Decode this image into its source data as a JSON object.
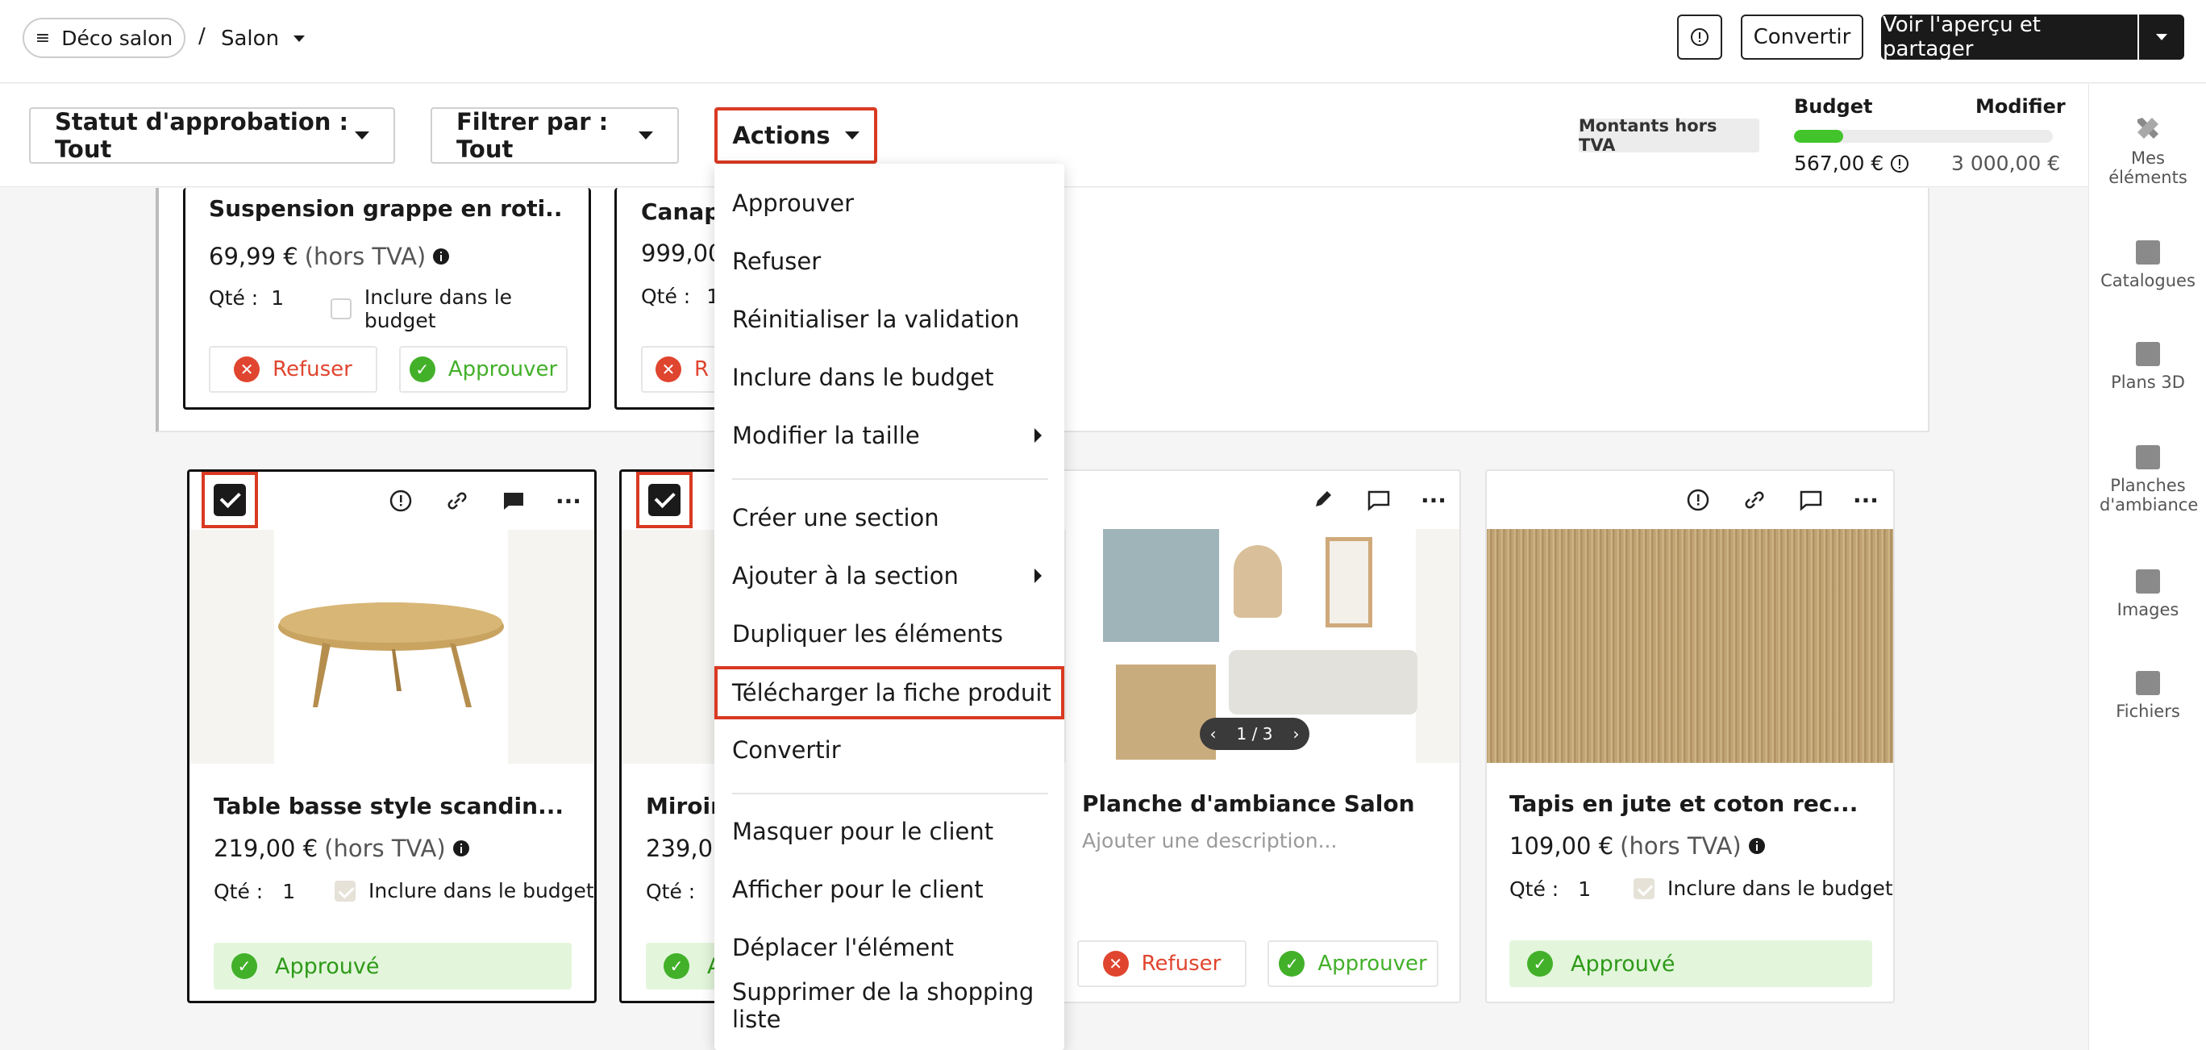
{
  "topbar": {
    "project_label": "Déco salon",
    "separator": "/",
    "room_label": "Salon",
    "convert_label": "Convertir",
    "share_label": "Voir l'aperçu et partager"
  },
  "filters": {
    "approval_status": "Statut d'approbation : Tout",
    "filter_by": "Filtrer par : Tout",
    "actions": "Actions",
    "vat_badge": "Montants hors TVA"
  },
  "budget": {
    "title": "Budget",
    "edit_label": "Modifier",
    "spent": "567,00 €",
    "total": "3 000,00 €",
    "fill_fraction": 0.189
  },
  "sidebar": {
    "items": [
      {
        "label": "Mes éléments",
        "icon": "tools-icon"
      },
      {
        "label": "Catalogues",
        "icon": "book-icon"
      },
      {
        "label": "Plans 3D",
        "icon": "floorplan-icon"
      },
      {
        "label": "Planches d'ambiance",
        "icon": "moodboard-icon"
      },
      {
        "label": "Images",
        "icon": "image-icon"
      },
      {
        "label": "Fichiers",
        "icon": "file-icon"
      }
    ]
  },
  "cards": {
    "c1": {
      "title": "Suspension grappe en roti...",
      "price": "69,99 €",
      "ht": "(hors TVA)",
      "qty_label": "Qté :",
      "qty": "1",
      "budget_label": "Inclure dans le budget",
      "refuse": "Refuser",
      "approve": "Approuver"
    },
    "c2": {
      "title": "Canape",
      "price": "999,00",
      "qty_label": "Qté :",
      "qty": "1",
      "refuse": "R"
    },
    "c3": {
      "title": "Table basse style scandin...",
      "price": "219,00 €",
      "ht": "(hors TVA)",
      "qty_label": "Qté :",
      "qty": "1",
      "budget_label": "Inclure dans le budget",
      "status": "Approuvé"
    },
    "c4": {
      "title": "Miroir",
      "price": "239,00",
      "qty_label": "Qté :",
      "qty": "1",
      "status": "A"
    },
    "c5": {
      "title": "Planche d'ambiance Salon",
      "desc_placeholder": "Ajouter une description...",
      "pager": "1 / 3",
      "refuse": "Refuser",
      "approve": "Approuver"
    },
    "c6": {
      "title": "Tapis en jute et coton rec...",
      "price": "109,00 €",
      "ht": "(hors TVA)",
      "qty_label": "Qté :",
      "qty": "1",
      "budget_label": "Inclure dans le budget",
      "status": "Approuvé"
    }
  },
  "menu": {
    "approve": "Approuver",
    "refuse": "Refuser",
    "reset": "Réinitialiser la validation",
    "include_budget": "Inclure dans le budget",
    "resize": "Modifier la taille",
    "create_section": "Créer une section",
    "add_to_section": "Ajouter à la section",
    "duplicate": "Dupliquer les éléments",
    "download_sheet": "Télécharger la fiche produit",
    "convert": "Convertir",
    "hide_client": "Masquer pour le client",
    "show_client": "Afficher pour le client",
    "move": "Déplacer l'élément",
    "delete": "Supprimer de la shopping liste"
  },
  "colors": {
    "accent_red": "#d93a22",
    "approve_green": "#43b02a",
    "dark": "#1a1a1a"
  }
}
